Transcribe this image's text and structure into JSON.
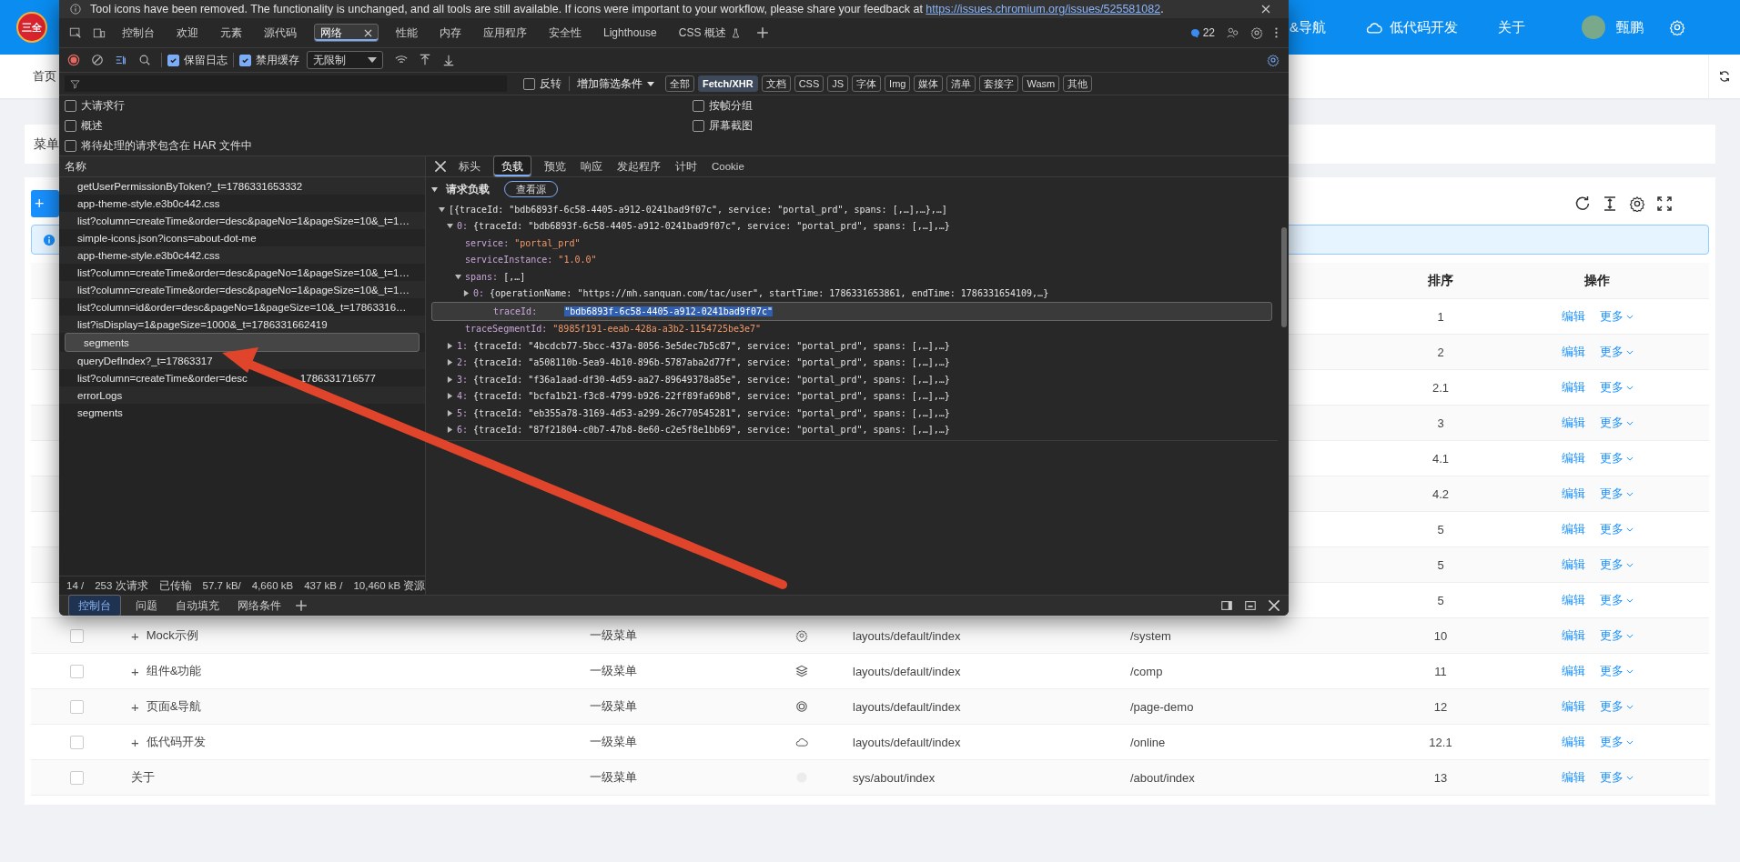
{
  "app_header": {
    "logo": "三全",
    "nav": [
      {
        "label": "&导航",
        "kind": "text"
      },
      {
        "label": "低代码开发",
        "kind": "cloud"
      },
      {
        "label": "关于",
        "kind": "text"
      }
    ],
    "user": "甄鹏"
  },
  "home_tab": "首页",
  "menu_card_title": "菜单",
  "add_button": "+",
  "table": {
    "sort_header": "排序",
    "actions_header": "操作",
    "rows": [
      {
        "sort": "1",
        "actions": [
          "编辑",
          "更多"
        ]
      },
      {
        "sort": "2",
        "actions": [
          "编辑",
          "更多"
        ]
      },
      {
        "sort": "2.1",
        "actions": [
          "编辑",
          "更多"
        ]
      },
      {
        "sort": "3",
        "actions": [
          "编辑",
          "更多"
        ]
      },
      {
        "sort": "4.1",
        "actions": [
          "编辑",
          "更多"
        ]
      },
      {
        "sort": "4.2",
        "actions": [
          "编辑",
          "更多"
        ]
      },
      {
        "sort": "5",
        "actions": [
          "编辑",
          "更多"
        ]
      },
      {
        "sort": "5",
        "actions": [
          "编辑",
          "更多"
        ]
      },
      {
        "sort": "5",
        "actions": [
          "编辑",
          "更多"
        ]
      },
      {
        "checked": false,
        "expand": "+",
        "name": "Mock示例",
        "type": "一级菜单",
        "kind": "gear",
        "component": "layouts/default/index",
        "path": "/system",
        "sort": "10",
        "actions": [
          "编辑",
          "更多"
        ]
      },
      {
        "checked": false,
        "expand": "+",
        "name": "组件&功能",
        "type": "一级菜单",
        "kind": "layers",
        "component": "layouts/default/index",
        "path": "/comp",
        "sort": "11",
        "actions": [
          "编辑",
          "更多"
        ]
      },
      {
        "checked": false,
        "expand": "+",
        "name": "页面&导航",
        "type": "一级菜单",
        "kind": "ring",
        "component": "layouts/default/index",
        "path": "/page-demo",
        "sort": "12",
        "actions": [
          "编辑",
          "更多"
        ]
      },
      {
        "checked": false,
        "expand": "+",
        "name": "低代码开发",
        "type": "一级菜单",
        "kind": "cloud",
        "component": "layouts/default/index",
        "path": "/online",
        "sort": "12.1",
        "actions": [
          "编辑",
          "更多"
        ]
      },
      {
        "checked": false,
        "name": "关于",
        "type": "一级菜单",
        "kind": "blank",
        "component": "sys/about/index",
        "path": "/about/index",
        "sort": "13",
        "actions": [
          "编辑",
          "更多"
        ]
      }
    ]
  },
  "devtools": {
    "notice": {
      "text": "Tool icons have been removed. The functionality is unchanged, and all tools are still available. If icons were important to your workflow, please share your feedback at ",
      "link": "https://issues.chromium.org/issues/525581082",
      "end": "."
    },
    "tabs": [
      {
        "label": "控制台",
        "selected": false,
        "kind": "plain"
      },
      {
        "label": "欢迎",
        "selected": false,
        "kind": "plain"
      },
      {
        "label": "元素",
        "selected": false,
        "kind": "plain"
      },
      {
        "label": "源代码",
        "selected": false,
        "kind": "plain"
      },
      {
        "label": "网络",
        "selected": true,
        "kind": "plain"
      },
      {
        "label": "性能",
        "selected": false,
        "kind": "plain"
      },
      {
        "label": "内存",
        "selected": false,
        "kind": "plain"
      },
      {
        "label": "应用程序",
        "selected": false,
        "kind": "plain"
      },
      {
        "label": "安全性",
        "selected": false,
        "kind": "plain"
      },
      {
        "label": "Lighthouse",
        "selected": false,
        "kind": "plain"
      },
      {
        "label": "CSS 概述",
        "selected": false,
        "kind": "flask"
      }
    ],
    "issues_count": "22",
    "toolbar": {
      "preserve_log": {
        "label": "保留日志",
        "checked": true
      },
      "disable_cache": {
        "label": "禁用缓存",
        "checked": true
      },
      "throttling": "无限制"
    },
    "filter": {
      "invert": {
        "label": "反转",
        "checked": false
      },
      "more_filters": "增加筛选条件",
      "types": [
        {
          "label": "全部",
          "selected": false
        },
        {
          "label": "Fetch/XHR",
          "selected": true
        },
        {
          "label": "文档",
          "selected": false
        },
        {
          "label": "CSS",
          "selected": false
        },
        {
          "label": "JS",
          "selected": false
        },
        {
          "label": "字体",
          "selected": false
        },
        {
          "label": "Img",
          "selected": false
        },
        {
          "label": "媒体",
          "selected": false
        },
        {
          "label": "清单",
          "selected": false
        },
        {
          "label": "套接字",
          "selected": false
        },
        {
          "label": "Wasm",
          "selected": false
        },
        {
          "label": "其他",
          "selected": false
        }
      ]
    },
    "options": [
      {
        "label": "大请求行",
        "checked": false
      },
      {
        "label": "按帧分组",
        "checked": false
      },
      {
        "label": "概述",
        "checked": false
      },
      {
        "label": "屏幕截图",
        "checked": false
      },
      {
        "label": "将待处理的请求包含在 HAR 文件中",
        "checked": false
      }
    ],
    "requests": {
      "header": "名称",
      "items": [
        {
          "name": "getUserPermissionByToken?_t=1786331653332",
          "selected": false
        },
        {
          "name": "app-theme-style.e3b0c442.css",
          "selected": false
        },
        {
          "name": "list?column=createTime&order=desc&pageNo=1&pageSize=10&_t=1…",
          "selected": false
        },
        {
          "name": "simple-icons.json?icons=about-dot-me",
          "selected": false
        },
        {
          "name": "app-theme-style.e3b0c442.css",
          "selected": false
        },
        {
          "name": "list?column=createTime&order=desc&pageNo=1&pageSize=10&_t=1…",
          "selected": false
        },
        {
          "name": "list?column=createTime&order=desc&pageNo=1&pageSize=10&_t=1…",
          "selected": false
        },
        {
          "name": "list?column=id&order=desc&pageNo=1&pageSize=10&_t=17863316…",
          "selected": false
        },
        {
          "name": "list?isDisplay=1&pageSize=1000&_t=1786331662419",
          "selected": false
        },
        {
          "name": "segments",
          "selected": true
        },
        {
          "name": "queryDefIndex?_t=17863317",
          "selected": false
        },
        {
          "name": "list?column=createTime&order=desc",
          "tail": "1786331716577",
          "selected": false
        },
        {
          "name": "errorLogs",
          "selected": false
        },
        {
          "name": "segments",
          "selected": false
        }
      ]
    },
    "status_bar": [
      "14 /",
      "253 次请求",
      "已传输",
      "57.7 kB/",
      "4,660 kB",
      "437 kB /",
      "10,460 kB 资源"
    ],
    "detail_tabs": [
      {
        "label": "标头",
        "selected": false
      },
      {
        "label": "负载",
        "selected": true
      },
      {
        "label": "预览",
        "selected": false
      },
      {
        "label": "响应",
        "selected": false
      },
      {
        "label": "发起程序",
        "selected": false
      },
      {
        "label": "计时",
        "selected": false
      },
      {
        "label": "Cookie",
        "selected": false
      }
    ],
    "payload": {
      "title": "请求负载",
      "expanded": true,
      "view_source": "查看源",
      "tree": [
        {
          "summary": "[{traceId: \"bdb6893f-6c58-4405-a912-0241bad9f07c\", service: \"portal_prd\", spans: [,…],…},…]",
          "expanded": true,
          "selected": false,
          "children": [
            {
              "key": "0:",
              "summary": "{traceId: \"bdb6893f-6c58-4405-a912-0241bad9f07c\", service: \"portal_prd\", spans: [,…],…}",
              "expanded": true,
              "selected": false,
              "children": [
                {
                  "key": "service:",
                  "value": "\"portal_prd\"",
                  "selected": false
                },
                {
                  "key": "serviceInstance:",
                  "value": "\"1.0.0\"",
                  "selected": false
                },
                {
                  "key": "spans:",
                  "summary": "[,…]",
                  "expanded": true,
                  "selected": false,
                  "children": [
                    {
                      "key": "0:",
                      "summary": "{operationName: \"https://mh.sanquan.com/tac/user\", startTime: 1786331653861, endTime: 1786331654109,…}",
                      "expanded": false,
                      "selected": false
                    }
                  ]
                },
                {
                  "key": "traceId:",
                  "value": "\"bdb6893f-6c58-4405-a912-0241bad9f07c\"",
                  "selected": true
                },
                {
                  "key": "traceSegmentId:",
                  "value": "\"8985f191-eeab-428a-a3b2-1154725be3e7\"",
                  "selected": false
                }
              ]
            },
            {
              "key": "1:",
              "summary": "{traceId: \"4bcdcb77-5bcc-437a-8056-3e5dec7b5c87\", service: \"portal_prd\", spans: [,…],…}",
              "expanded": false,
              "selected": false
            },
            {
              "key": "2:",
              "summary": "{traceId: \"a508110b-5ea9-4b10-896b-5787aba2d77f\", service: \"portal_prd\", spans: [,…],…}",
              "expanded": false,
              "selected": false
            },
            {
              "key": "3:",
              "summary": "{traceId: \"f36a1aad-df30-4d59-aa27-89649378a85e\", service: \"portal_prd\", spans: [,…],…}",
              "expanded": false,
              "selected": false
            },
            {
              "key": "4:",
              "summary": "{traceId: \"bcfa1b21-f3c8-4799-b926-22ff89fa69b8\", service: \"portal_prd\", spans: [,…],…}",
              "expanded": false,
              "selected": false
            },
            {
              "key": "5:",
              "summary": "{traceId: \"eb355a78-3169-4d53-a299-26c770545281\", service: \"portal_prd\", spans: [,…],…}",
              "expanded": false,
              "selected": false
            },
            {
              "key": "6:",
              "summary": "{traceId: \"87f21804-c0b7-47b8-8e60-c2e5f8e1bb69\", service: \"portal_prd\", spans: [,…],…}",
              "expanded": false,
              "selected": false
            }
          ]
        }
      ]
    },
    "drawer_tabs": [
      {
        "label": "控制台",
        "selected": true
      },
      {
        "label": "问题",
        "selected": false
      },
      {
        "label": "自动填充",
        "selected": false
      },
      {
        "label": "网络条件",
        "selected": false
      }
    ]
  }
}
